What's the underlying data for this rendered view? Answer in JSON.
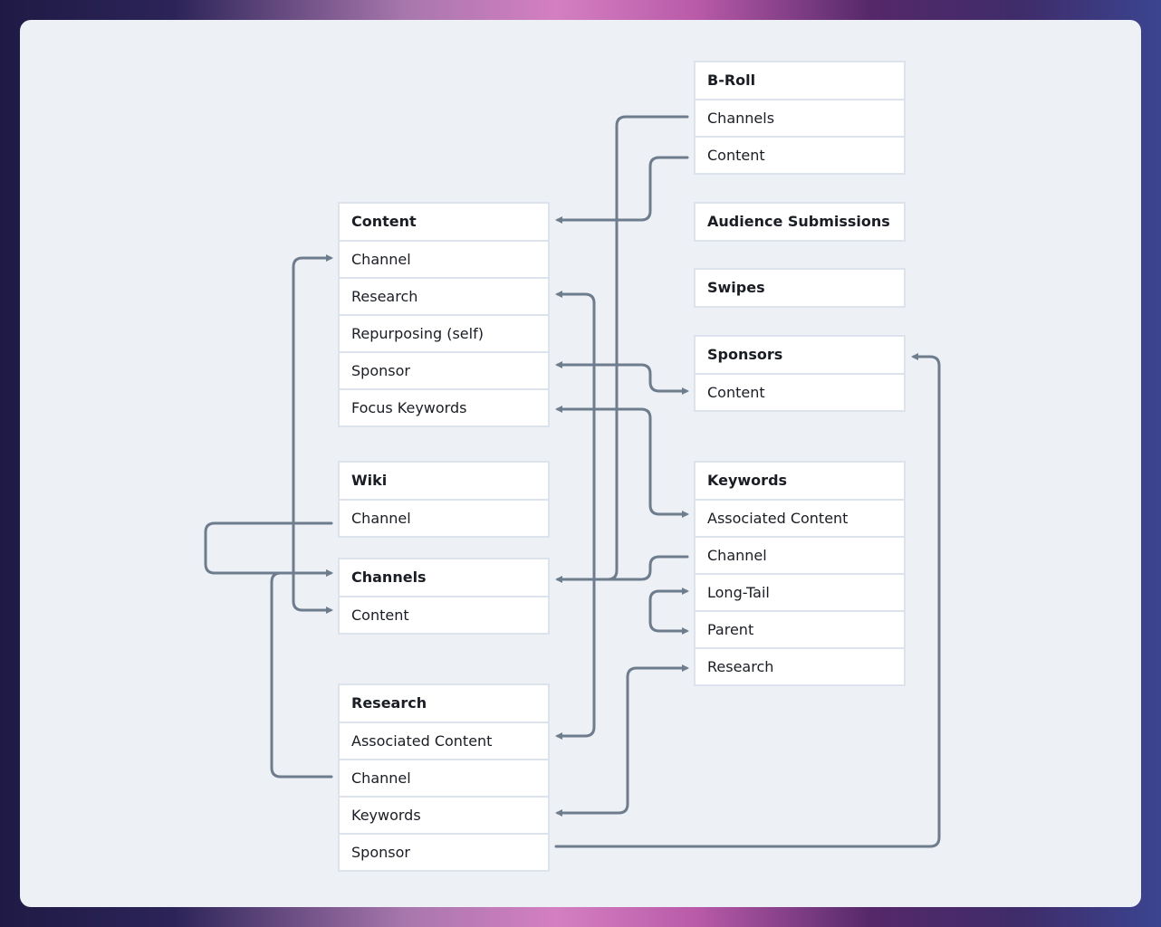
{
  "tables": {
    "content": {
      "title": "Content",
      "rows": [
        "Channel",
        "Research",
        "Repurposing (self)",
        "Sponsor",
        "Focus Keywords"
      ]
    },
    "wiki": {
      "title": "Wiki",
      "rows": [
        "Channel"
      ]
    },
    "channels": {
      "title": "Channels",
      "rows": [
        "Content"
      ]
    },
    "research": {
      "title": "Research",
      "rows": [
        "Associated Content",
        "Channel",
        "Keywords",
        "Sponsor"
      ]
    },
    "broll": {
      "title": "B-Roll",
      "rows": [
        "Channels",
        "Content"
      ]
    },
    "audience": {
      "title": "Audience Submissions",
      "rows": []
    },
    "swipes": {
      "title": "Swipes",
      "rows": []
    },
    "sponsors": {
      "title": "Sponsors",
      "rows": [
        "Content"
      ]
    },
    "keywords": {
      "title": "Keywords",
      "rows": [
        "Associated Content",
        "Channel",
        "Long-Tail",
        "Parent",
        "Research"
      ]
    }
  },
  "colors": {
    "connector": "#6e7d8e",
    "card": "#edf0f5",
    "border": "#dde3ec"
  }
}
